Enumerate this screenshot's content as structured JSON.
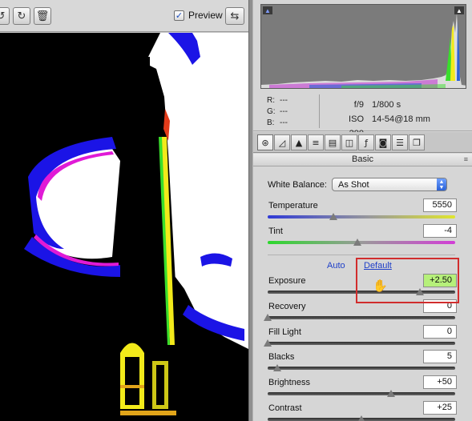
{
  "toolbar": {
    "rotate_left_icon": "rotate-ccw-icon",
    "rotate_right_icon": "rotate-cw-icon",
    "trash_icon": "trash-icon",
    "preview_label": "Preview",
    "preview_checked": true,
    "fullscreen_icon": "expand-arrows-icon"
  },
  "histogram": {
    "shadow_warning_icon": "shadow-clip-icon",
    "highlight_warning_icon": "highlight-clip-icon"
  },
  "readout": {
    "r_label": "R:",
    "r_value": "---",
    "g_label": "G:",
    "g_value": "---",
    "b_label": "B:",
    "b_value": "---",
    "aperture": "f/9",
    "shutter": "1/800 s",
    "iso": "ISO 200",
    "lens": "14-54@18 mm"
  },
  "tabs": [
    {
      "icon": "aperture-icon"
    },
    {
      "icon": "tone-curve-icon"
    },
    {
      "icon": "detail-icon"
    },
    {
      "icon": "hsl-icon"
    },
    {
      "icon": "split-toning-icon"
    },
    {
      "icon": "lens-corrections-icon"
    },
    {
      "icon": "fx-icon"
    },
    {
      "icon": "camera-calibration-icon"
    },
    {
      "icon": "presets-icon"
    },
    {
      "icon": "snapshots-icon"
    }
  ],
  "basic": {
    "section_title": "Basic",
    "white_balance_label": "White Balance:",
    "white_balance_value": "As Shot",
    "auto_label": "Auto",
    "default_label": "Default",
    "controls": [
      {
        "name": "Temperature",
        "value": "5550",
        "level": 0.35
      },
      {
        "name": "Tint",
        "value": "-4",
        "level": 0.48
      },
      {
        "name": "Exposure",
        "value": "+2.50",
        "level": 0.81
      },
      {
        "name": "Recovery",
        "value": "0",
        "level": 0.0
      },
      {
        "name": "Fill Light",
        "value": "0",
        "level": 0.0
      },
      {
        "name": "Blacks",
        "value": "5",
        "level": 0.05
      },
      {
        "name": "Brightness",
        "value": "+50",
        "level": 0.66
      },
      {
        "name": "Contrast",
        "value": "+25",
        "level": 0.5
      }
    ]
  }
}
